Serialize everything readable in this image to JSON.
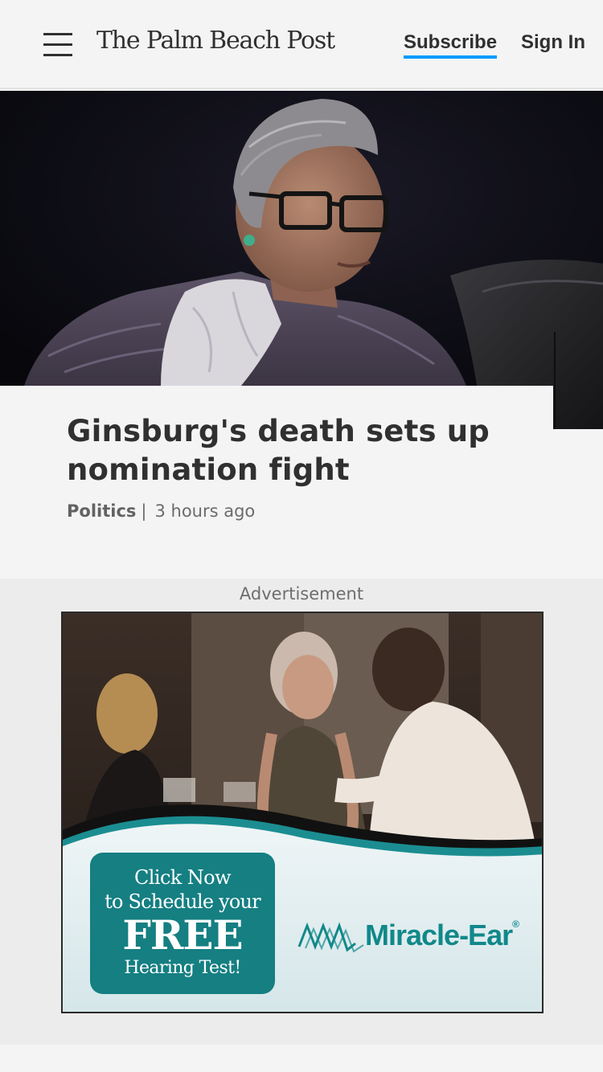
{
  "header": {
    "logo": "The Palm Beach Post",
    "subscribe_label": "Subscribe",
    "signin_label": "Sign In",
    "menu_icon": "hamburger-menu-icon",
    "accent_color": "#009bff"
  },
  "article": {
    "headline": "Ginsburg's death sets up nomination fight",
    "category": "Politics",
    "separator": "|",
    "timestamp": "3 hours ago"
  },
  "advertisement": {
    "label": "Advertisement",
    "cta_line1": "Click Now",
    "cta_line2": "to Schedule your",
    "cta_line3": "FREE",
    "cta_line4": "Hearing Test!",
    "brand": "Miracle-Ear",
    "brand_mark": "®",
    "brand_color": "#11888a"
  }
}
